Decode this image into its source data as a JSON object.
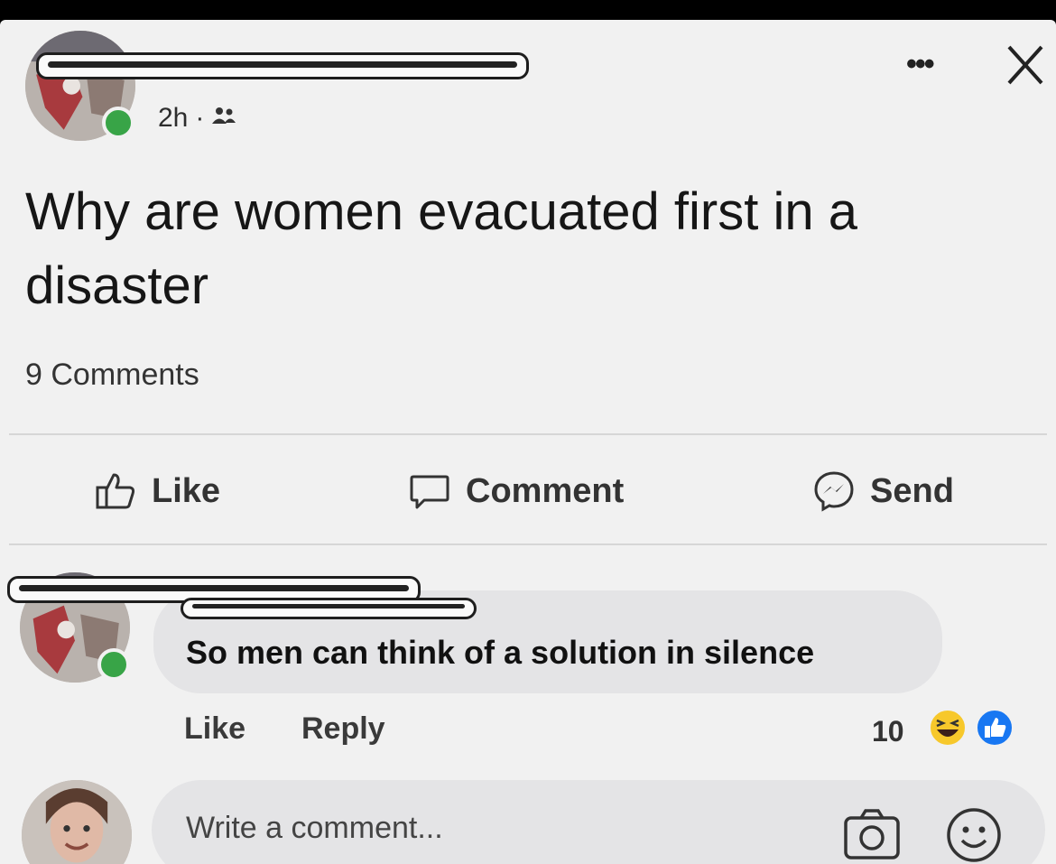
{
  "post": {
    "timestamp": "2h",
    "separator": "·",
    "audience_icon": "friends-icon",
    "text": "Why are women evacuated first in a disaster",
    "comment_count": "9 Comments",
    "more_icon": "•••",
    "close_icon": "close-icon"
  },
  "actions": {
    "like": "Like",
    "comment": "Comment",
    "send": "Send"
  },
  "comment": {
    "text": "So men can think of a solution in silence",
    "like": "Like",
    "reply": "Reply",
    "reaction_count": "10",
    "reactions": [
      "haha-reaction-icon",
      "like-reaction-icon"
    ]
  },
  "composer": {
    "placeholder": "Write a comment...",
    "camera_icon": "camera-icon",
    "emoji_icon": "emoji-icon"
  },
  "colors": {
    "background": "#f1f1f1",
    "online": "#38a447",
    "like_reaction": "#1877f2",
    "haha_reaction": "#f7c82b"
  }
}
